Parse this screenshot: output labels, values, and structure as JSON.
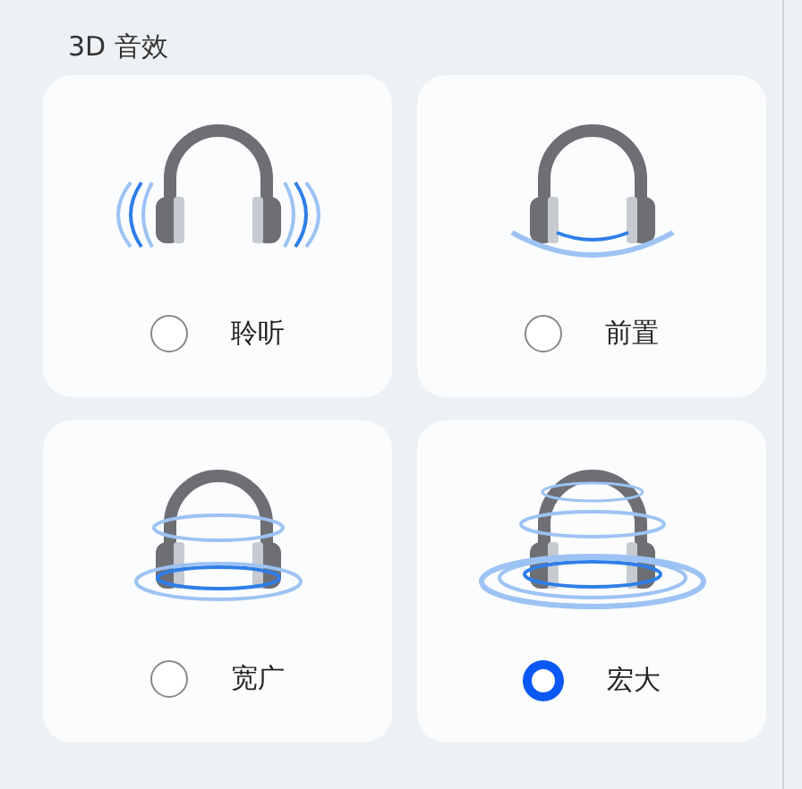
{
  "title": "3D 音效",
  "modes": [
    {
      "label": "聆听",
      "kind": "sides",
      "selected": false
    },
    {
      "label": "前置",
      "kind": "front",
      "selected": false
    },
    {
      "label": "宽广",
      "kind": "wide",
      "selected": false
    },
    {
      "label": "宏大",
      "kind": "grand",
      "selected": true
    }
  ]
}
